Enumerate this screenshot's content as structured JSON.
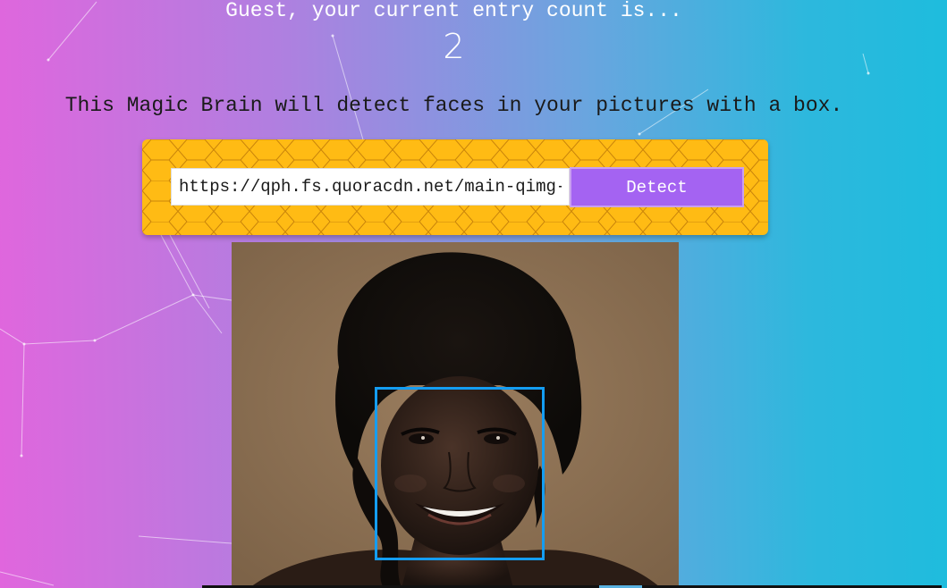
{
  "header": {
    "greeting": "Guest, your current entry count is...",
    "entry_count": "2"
  },
  "intro": {
    "tagline": "This Magic Brain will detect faces in your pictures with a box."
  },
  "image_form": {
    "url_value": "https://qph.fs.quoracdn.net/main-qimg-",
    "detect_label": "Detect"
  },
  "result": {
    "photo_description": "portrait of smiling woman",
    "faces_detected": 1
  },
  "colors": {
    "panel": "#ffbb14",
    "button": "#a463f2",
    "face_box": "#149df2",
    "bg_left": "#e066dd",
    "bg_right": "#1ebcdd"
  }
}
